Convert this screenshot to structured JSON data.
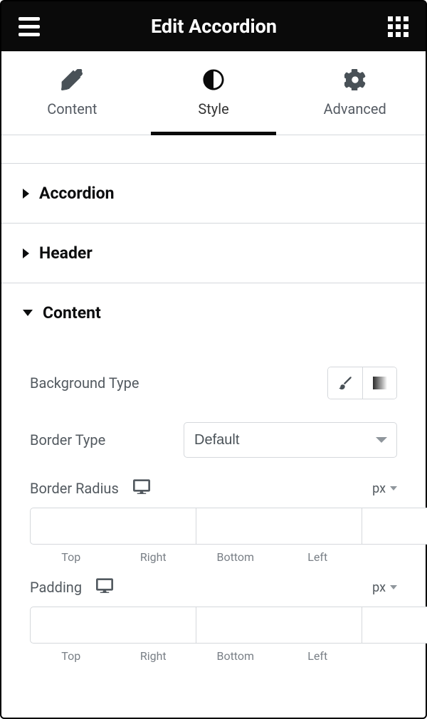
{
  "header": {
    "title": "Edit Accordion"
  },
  "tabs": {
    "content": "Content",
    "style": "Style",
    "advanced": "Advanced",
    "active": "style"
  },
  "sections": {
    "accordion": "Accordion",
    "header": "Header",
    "content": "Content"
  },
  "controls": {
    "background_type_label": "Background Type",
    "border_type_label": "Border Type",
    "border_type_value": "Default",
    "border_radius_label": "Border Radius",
    "padding_label": "Padding",
    "unit_px": "px",
    "sides": {
      "top": "Top",
      "right": "Right",
      "bottom": "Bottom",
      "left": "Left"
    }
  }
}
